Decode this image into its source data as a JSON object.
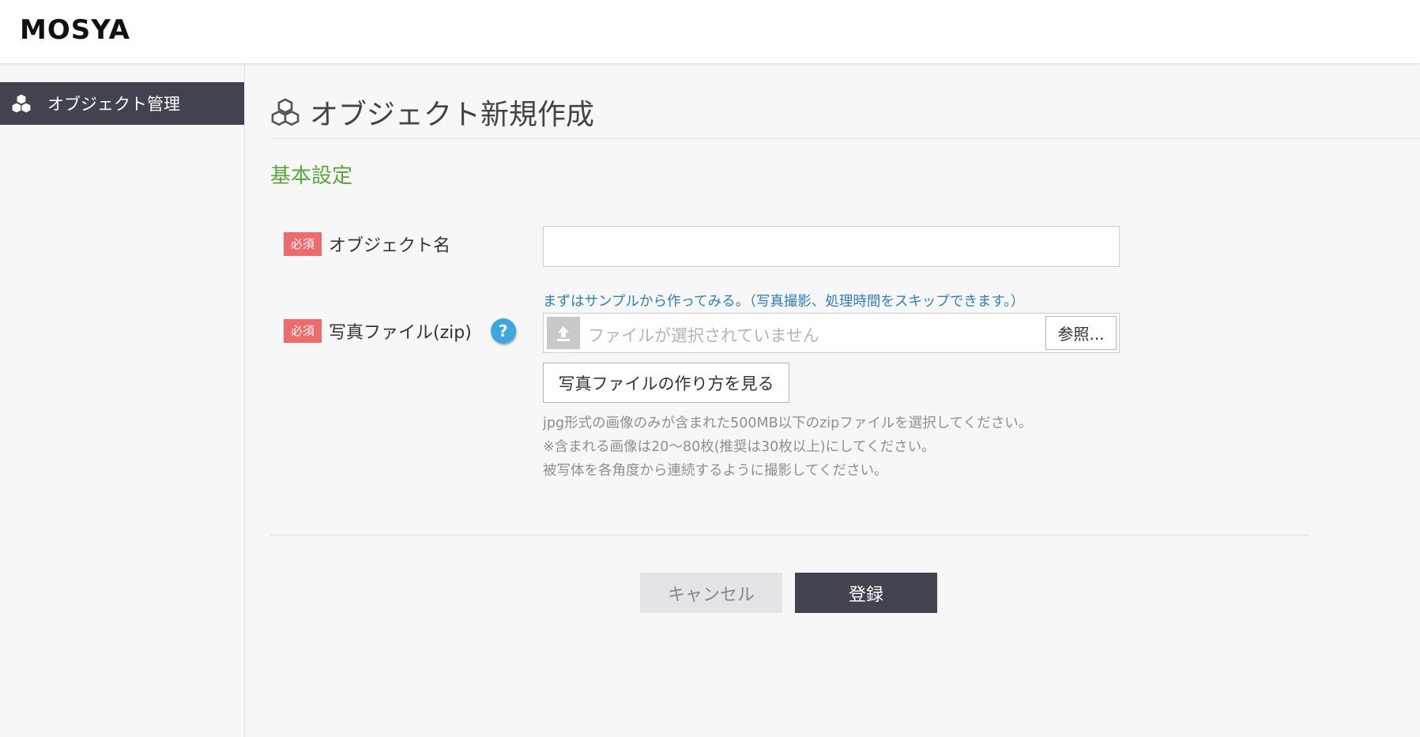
{
  "app": {
    "logo": "MOSYA"
  },
  "sidebar": {
    "items": [
      {
        "label": "オブジェクト管理",
        "icon": "cubes-icon",
        "active": true
      }
    ]
  },
  "page": {
    "title": "オブジェクト新規作成",
    "title_icon": "cubes-icon"
  },
  "section": {
    "title": "基本設定"
  },
  "form": {
    "required_badge": "必須",
    "object_name": {
      "label": "オブジェクト名",
      "value": ""
    },
    "photo_file": {
      "label": "写真ファイル(zip)",
      "help_icon": "?",
      "sample_link": "まずはサンプルから作ってみる。（写真撮影、処理時間をスキップできます。）",
      "placeholder": "ファイルが選択されていません",
      "browse_label": "参照...",
      "howto_label": "写真ファイルの作り方を見る",
      "notes": [
        "jpg形式の画像のみが含まれた500MB以下のzipファイルを選択してください。",
        "※含まれる画像は20〜80枚(推奨は30枚以上)にしてください。",
        "被写体を各角度から連続するように撮影してください。"
      ]
    }
  },
  "actions": {
    "cancel_label": "キャンセル",
    "submit_label": "登録"
  },
  "colors": {
    "accent_dark": "#41434e",
    "section_green": "#5aa83c",
    "required_red": "#ef6a6a",
    "link_blue": "#2d7fc2",
    "help_blue": "#3ea7df"
  }
}
